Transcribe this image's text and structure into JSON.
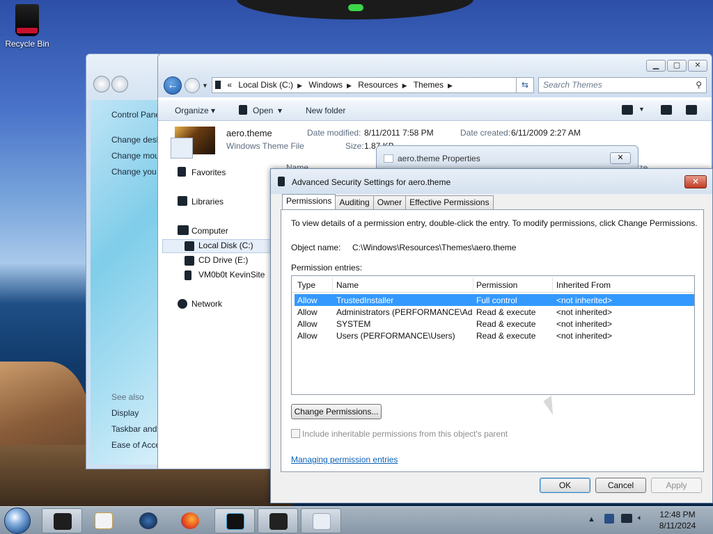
{
  "desktop": {
    "recycle_bin_label": "Recycle Bin"
  },
  "control_panel": {
    "links": [
      "Control Panel",
      "Change desk",
      "Change mou",
      "Change you"
    ],
    "see_also": "See also",
    "see_also_links": [
      "Display",
      "Taskbar and",
      "Ease of Acce"
    ]
  },
  "explorer": {
    "address": {
      "prefix": "«",
      "crumbs": [
        "Local Disk (C:)",
        "Windows",
        "Resources",
        "Themes"
      ]
    },
    "search_placeholder": "Search Themes",
    "toolbar": {
      "organize": "Organize",
      "open": "Open",
      "new_folder": "New folder"
    },
    "details": {
      "file_name": "aero.theme",
      "file_type": "Windows Theme File",
      "date_modified_label": "Date modified:",
      "date_modified": "8/11/2011 7:58 PM",
      "date_created_label": "Date created:",
      "date_created": "6/11/2009 2:27 AM",
      "size_label": "Size:",
      "size": "1.87 KB"
    },
    "nav": {
      "favorites": "Favorites",
      "libraries": "Libraries",
      "computer": "Computer",
      "local_disk": "Local Disk (C:)",
      "cd_drive": "CD Drive (E:)",
      "share": "VM0b0t KevinSite",
      "network": "Network"
    },
    "column_name": "Name",
    "column_size": "ize"
  },
  "properties_window": {
    "title": "aero.theme Properties"
  },
  "advanced": {
    "title": "Advanced Security Settings for aero.theme",
    "tabs": [
      "Permissions",
      "Auditing",
      "Owner",
      "Effective Permissions"
    ],
    "instructions": "To view details of a permission entry, double-click the entry. To modify permissions, click Change Permissions.",
    "object_name_label": "Object name:",
    "object_name": "C:\\Windows\\Resources\\Themes\\aero.theme",
    "entries_label": "Permission entries:",
    "columns": [
      "Type",
      "Name",
      "Permission",
      "Inherited From"
    ],
    "rows": [
      {
        "type": "Allow",
        "name": "TrustedInstaller",
        "permission": "Full control",
        "inherited": "<not inherited>",
        "selected": true
      },
      {
        "type": "Allow",
        "name": "Administrators (PERFORMANCE\\Adm...",
        "permission": "Read & execute",
        "inherited": "<not inherited>",
        "selected": false
      },
      {
        "type": "Allow",
        "name": "SYSTEM",
        "permission": "Read & execute",
        "inherited": "<not inherited>",
        "selected": false
      },
      {
        "type": "Allow",
        "name": "Users (PERFORMANCE\\Users)",
        "permission": "Read & execute",
        "inherited": "<not inherited>",
        "selected": false
      }
    ],
    "change_permissions": "Change Permissions...",
    "include_inheritable": "Include inheritable permissions from this object's parent",
    "manage_link": "Managing permission entries",
    "ok": "OK",
    "cancel": "Cancel",
    "apply": "Apply"
  },
  "taskbar": {
    "time": "12:48 PM",
    "date": "8/11/2024"
  },
  "colors": {
    "selection": "#3399ff",
    "link": "#0b61b5",
    "close_button": "#c23a22"
  }
}
